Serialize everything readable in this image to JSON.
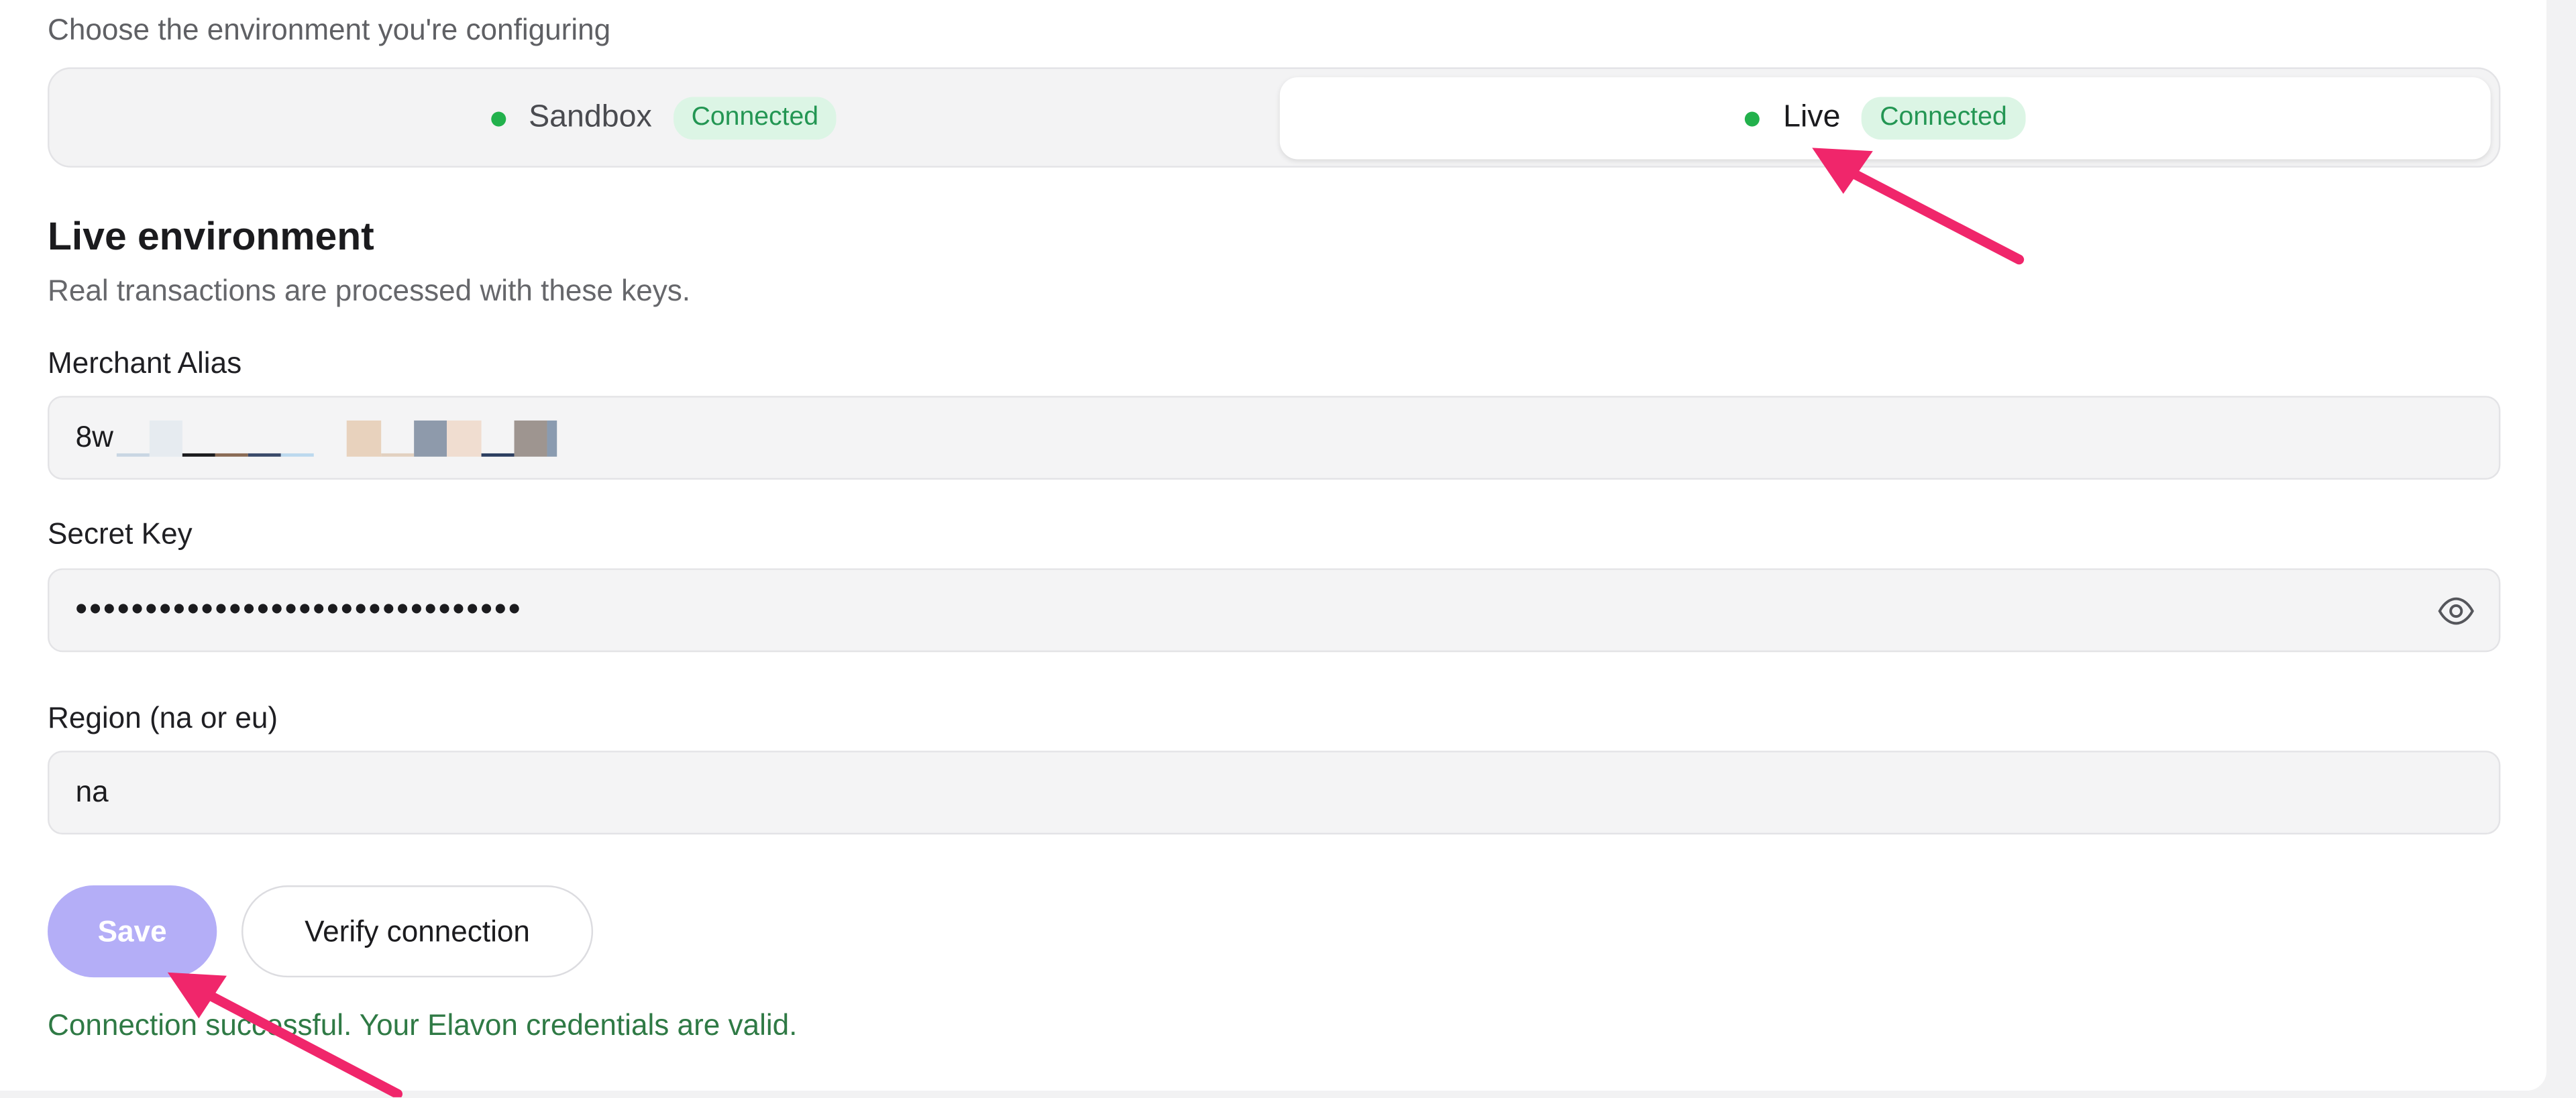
{
  "environment": {
    "caption": "Choose the environment you're configuring",
    "options": [
      {
        "label": "Sandbox",
        "status": "Connected",
        "selected": false
      },
      {
        "label": "Live",
        "status": "Connected",
        "selected": true
      }
    ]
  },
  "section": {
    "title": "Live environment",
    "subtitle": "Real transactions are processed with these keys."
  },
  "fields": {
    "merchant_alias": {
      "label": "Merchant Alias",
      "value_prefix": "8w"
    },
    "secret_key": {
      "label": "Secret Key",
      "value": "••••••••••••••••••••••••••••••••"
    },
    "region": {
      "label": "Region (na or eu)",
      "value": "na"
    }
  },
  "actions": {
    "save_label": "Save",
    "verify_label": "Verify connection"
  },
  "status_message": "Connection successful. Your Elavon credentials are valid.",
  "colors": {
    "accent_disabled": "#b4aef7",
    "success_green": "#22b14c",
    "annotation_arrow": "#f0266b"
  },
  "icons": {
    "reveal": "eye-icon",
    "status": "status-dot-icon"
  }
}
